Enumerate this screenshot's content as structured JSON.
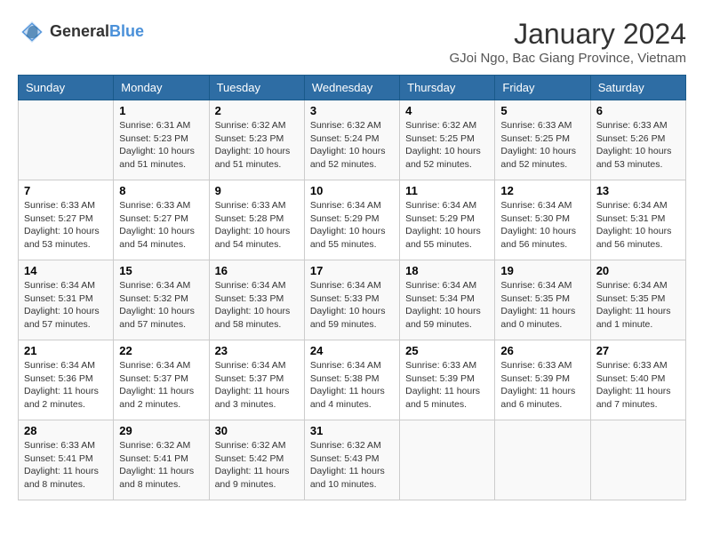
{
  "header": {
    "logo_line1": "General",
    "logo_line2": "Blue",
    "month": "January 2024",
    "location": "GJoi Ngo, Bac Giang Province, Vietnam"
  },
  "days_of_week": [
    "Sunday",
    "Monday",
    "Tuesday",
    "Wednesday",
    "Thursday",
    "Friday",
    "Saturday"
  ],
  "weeks": [
    [
      {
        "day": "",
        "sunrise": "",
        "sunset": "",
        "daylight": ""
      },
      {
        "day": "1",
        "sunrise": "Sunrise: 6:31 AM",
        "sunset": "Sunset: 5:23 PM",
        "daylight": "Daylight: 10 hours and 51 minutes."
      },
      {
        "day": "2",
        "sunrise": "Sunrise: 6:32 AM",
        "sunset": "Sunset: 5:23 PM",
        "daylight": "Daylight: 10 hours and 51 minutes."
      },
      {
        "day": "3",
        "sunrise": "Sunrise: 6:32 AM",
        "sunset": "Sunset: 5:24 PM",
        "daylight": "Daylight: 10 hours and 52 minutes."
      },
      {
        "day": "4",
        "sunrise": "Sunrise: 6:32 AM",
        "sunset": "Sunset: 5:25 PM",
        "daylight": "Daylight: 10 hours and 52 minutes."
      },
      {
        "day": "5",
        "sunrise": "Sunrise: 6:33 AM",
        "sunset": "Sunset: 5:25 PM",
        "daylight": "Daylight: 10 hours and 52 minutes."
      },
      {
        "day": "6",
        "sunrise": "Sunrise: 6:33 AM",
        "sunset": "Sunset: 5:26 PM",
        "daylight": "Daylight: 10 hours and 53 minutes."
      }
    ],
    [
      {
        "day": "7",
        "sunrise": "Sunrise: 6:33 AM",
        "sunset": "Sunset: 5:27 PM",
        "daylight": "Daylight: 10 hours and 53 minutes."
      },
      {
        "day": "8",
        "sunrise": "Sunrise: 6:33 AM",
        "sunset": "Sunset: 5:27 PM",
        "daylight": "Daylight: 10 hours and 54 minutes."
      },
      {
        "day": "9",
        "sunrise": "Sunrise: 6:33 AM",
        "sunset": "Sunset: 5:28 PM",
        "daylight": "Daylight: 10 hours and 54 minutes."
      },
      {
        "day": "10",
        "sunrise": "Sunrise: 6:34 AM",
        "sunset": "Sunset: 5:29 PM",
        "daylight": "Daylight: 10 hours and 55 minutes."
      },
      {
        "day": "11",
        "sunrise": "Sunrise: 6:34 AM",
        "sunset": "Sunset: 5:29 PM",
        "daylight": "Daylight: 10 hours and 55 minutes."
      },
      {
        "day": "12",
        "sunrise": "Sunrise: 6:34 AM",
        "sunset": "Sunset: 5:30 PM",
        "daylight": "Daylight: 10 hours and 56 minutes."
      },
      {
        "day": "13",
        "sunrise": "Sunrise: 6:34 AM",
        "sunset": "Sunset: 5:31 PM",
        "daylight": "Daylight: 10 hours and 56 minutes."
      }
    ],
    [
      {
        "day": "14",
        "sunrise": "Sunrise: 6:34 AM",
        "sunset": "Sunset: 5:31 PM",
        "daylight": "Daylight: 10 hours and 57 minutes."
      },
      {
        "day": "15",
        "sunrise": "Sunrise: 6:34 AM",
        "sunset": "Sunset: 5:32 PM",
        "daylight": "Daylight: 10 hours and 57 minutes."
      },
      {
        "day": "16",
        "sunrise": "Sunrise: 6:34 AM",
        "sunset": "Sunset: 5:33 PM",
        "daylight": "Daylight: 10 hours and 58 minutes."
      },
      {
        "day": "17",
        "sunrise": "Sunrise: 6:34 AM",
        "sunset": "Sunset: 5:33 PM",
        "daylight": "Daylight: 10 hours and 59 minutes."
      },
      {
        "day": "18",
        "sunrise": "Sunrise: 6:34 AM",
        "sunset": "Sunset: 5:34 PM",
        "daylight": "Daylight: 10 hours and 59 minutes."
      },
      {
        "day": "19",
        "sunrise": "Sunrise: 6:34 AM",
        "sunset": "Sunset: 5:35 PM",
        "daylight": "Daylight: 11 hours and 0 minutes."
      },
      {
        "day": "20",
        "sunrise": "Sunrise: 6:34 AM",
        "sunset": "Sunset: 5:35 PM",
        "daylight": "Daylight: 11 hours and 1 minute."
      }
    ],
    [
      {
        "day": "21",
        "sunrise": "Sunrise: 6:34 AM",
        "sunset": "Sunset: 5:36 PM",
        "daylight": "Daylight: 11 hours and 2 minutes."
      },
      {
        "day": "22",
        "sunrise": "Sunrise: 6:34 AM",
        "sunset": "Sunset: 5:37 PM",
        "daylight": "Daylight: 11 hours and 2 minutes."
      },
      {
        "day": "23",
        "sunrise": "Sunrise: 6:34 AM",
        "sunset": "Sunset: 5:37 PM",
        "daylight": "Daylight: 11 hours and 3 minutes."
      },
      {
        "day": "24",
        "sunrise": "Sunrise: 6:34 AM",
        "sunset": "Sunset: 5:38 PM",
        "daylight": "Daylight: 11 hours and 4 minutes."
      },
      {
        "day": "25",
        "sunrise": "Sunrise: 6:33 AM",
        "sunset": "Sunset: 5:39 PM",
        "daylight": "Daylight: 11 hours and 5 minutes."
      },
      {
        "day": "26",
        "sunrise": "Sunrise: 6:33 AM",
        "sunset": "Sunset: 5:39 PM",
        "daylight": "Daylight: 11 hours and 6 minutes."
      },
      {
        "day": "27",
        "sunrise": "Sunrise: 6:33 AM",
        "sunset": "Sunset: 5:40 PM",
        "daylight": "Daylight: 11 hours and 7 minutes."
      }
    ],
    [
      {
        "day": "28",
        "sunrise": "Sunrise: 6:33 AM",
        "sunset": "Sunset: 5:41 PM",
        "daylight": "Daylight: 11 hours and 8 minutes."
      },
      {
        "day": "29",
        "sunrise": "Sunrise: 6:32 AM",
        "sunset": "Sunset: 5:41 PM",
        "daylight": "Daylight: 11 hours and 8 minutes."
      },
      {
        "day": "30",
        "sunrise": "Sunrise: 6:32 AM",
        "sunset": "Sunset: 5:42 PM",
        "daylight": "Daylight: 11 hours and 9 minutes."
      },
      {
        "day": "31",
        "sunrise": "Sunrise: 6:32 AM",
        "sunset": "Sunset: 5:43 PM",
        "daylight": "Daylight: 11 hours and 10 minutes."
      },
      {
        "day": "",
        "sunrise": "",
        "sunset": "",
        "daylight": ""
      },
      {
        "day": "",
        "sunrise": "",
        "sunset": "",
        "daylight": ""
      },
      {
        "day": "",
        "sunrise": "",
        "sunset": "",
        "daylight": ""
      }
    ]
  ]
}
